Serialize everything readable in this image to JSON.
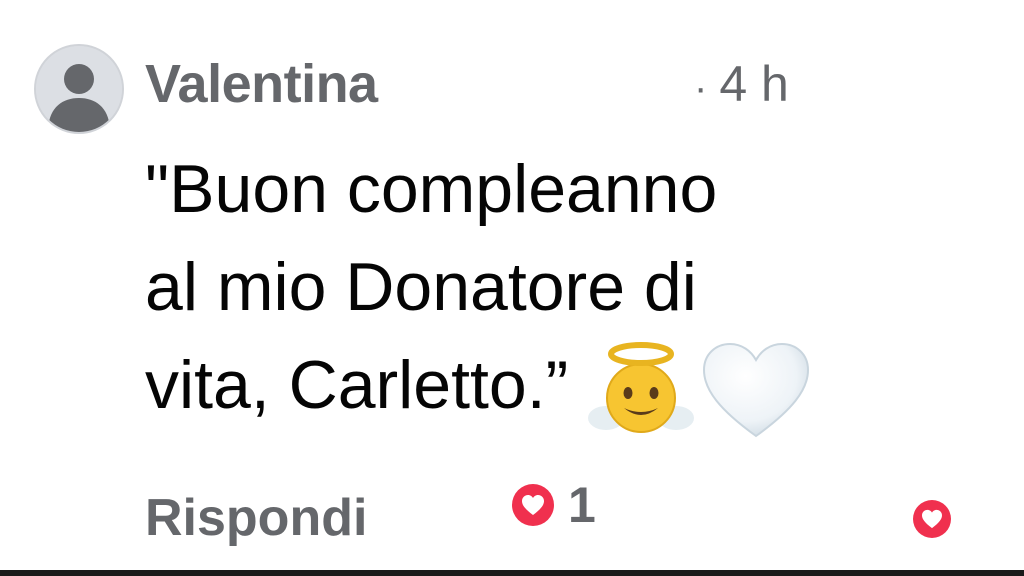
{
  "comment": {
    "author": "Valentina",
    "time_separator": "·",
    "time": "4 h",
    "text_lines": [
      "\"Buon compleanno",
      "al mio Donatore di",
      "vita, Carletto.”"
    ],
    "emojis": [
      "angel-face-icon",
      "white-heart-icon"
    ]
  },
  "footer": {
    "reply_label": "Rispondi",
    "reaction_count": "1",
    "reaction_type": "love-reaction-icon"
  },
  "colors": {
    "secondary_text": "#65676b",
    "primary_text": "#050505",
    "love_reaction": "#f0304e"
  }
}
